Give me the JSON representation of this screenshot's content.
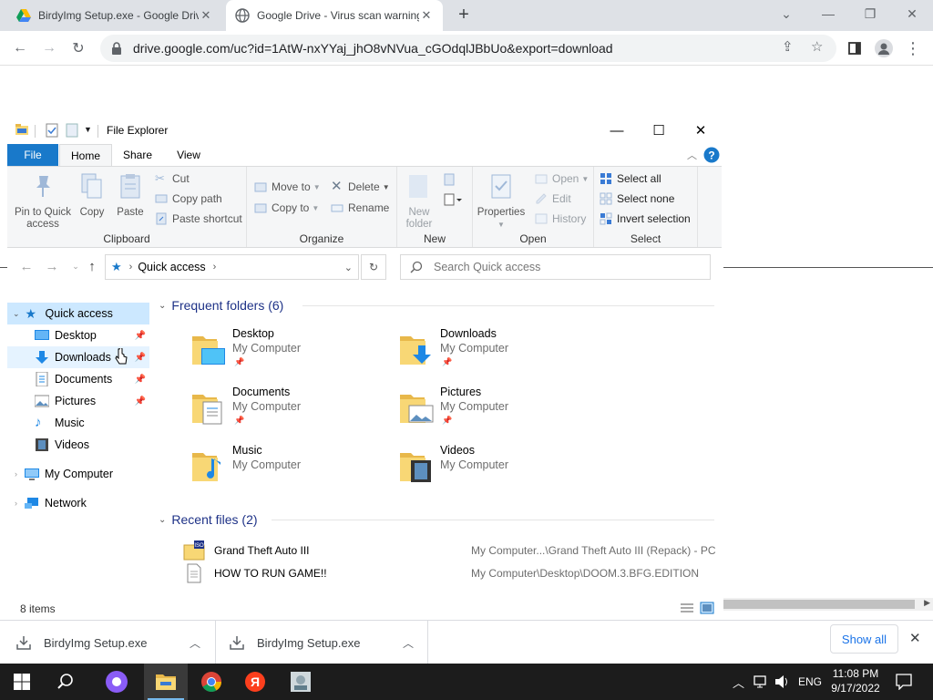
{
  "browser": {
    "tabs": [
      {
        "title": "BirdyImg Setup.exe - Google Drive",
        "active": false
      },
      {
        "title": "Google Drive - Virus scan warning",
        "active": true
      }
    ],
    "url": "drive.google.com/uc?id=1AtW-nxYYaj_jhO8vNVua_cGOdqlJBbUo&export=download"
  },
  "explorer": {
    "title": "File Explorer",
    "ribbon_tabs": [
      "File",
      "Home",
      "Share",
      "View"
    ],
    "clipboard": {
      "pin_label": "Pin to Quick access",
      "copy_label": "Copy",
      "paste_label": "Paste",
      "cut_label": "Cut",
      "copy_path_label": "Copy path",
      "paste_shortcut_label": "Paste shortcut",
      "group_label": "Clipboard"
    },
    "organize": {
      "move_to_label": "Move to",
      "copy_to_label": "Copy to",
      "delete_label": "Delete",
      "rename_label": "Rename",
      "group_label": "Organize"
    },
    "new": {
      "new_folder_label": "New folder",
      "group_label": "New"
    },
    "open": {
      "properties_label": "Properties",
      "open_label": "Open",
      "edit_label": "Edit",
      "history_label": "History",
      "group_label": "Open"
    },
    "select": {
      "select_all_label": "Select all",
      "select_none_label": "Select none",
      "invert_label": "Invert selection",
      "group_label": "Select"
    },
    "address": "Quick access",
    "search_placeholder": "Search Quick access",
    "nav": {
      "quick_access": "Quick access",
      "items": [
        "Desktop",
        "Downloads",
        "Documents",
        "Pictures",
        "Music",
        "Videos"
      ],
      "my_computer": "My Computer",
      "network": "Network"
    },
    "frequent_header": "Frequent folders (6)",
    "folders": [
      {
        "name": "Desktop",
        "location": "My Computer"
      },
      {
        "name": "Downloads",
        "location": "My Computer"
      },
      {
        "name": "Documents",
        "location": "My Computer"
      },
      {
        "name": "Pictures",
        "location": "My Computer"
      },
      {
        "name": "Music",
        "location": "My Computer"
      },
      {
        "name": "Videos",
        "location": "My Computer"
      }
    ],
    "recent_header": "Recent files (2)",
    "recent_files": [
      {
        "name": "Grand Theft Auto III",
        "path": "My Computer...\\Grand Theft Auto III (Repack) - PC"
      },
      {
        "name": "HOW TO RUN GAME!!",
        "path": "My Computer\\Desktop\\DOOM.3.BFG.EDITION"
      }
    ],
    "status": "8 items"
  },
  "downloads": {
    "items": [
      "BirdyImg Setup.exe",
      "BirdyImg Setup.exe"
    ],
    "show_all": "Show all"
  },
  "taskbar": {
    "language": "ENG",
    "time": "11:08 PM",
    "date": "9/17/2022"
  },
  "colors": {
    "accent": "#1979ca",
    "folder_yellow": "#f8d775",
    "nav_selected": "#cce8ff"
  }
}
